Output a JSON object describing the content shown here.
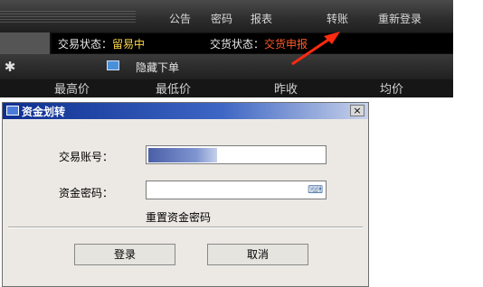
{
  "top_menu": {
    "items": [
      "公告",
      "密码",
      "报表",
      "转账",
      "重新登录"
    ]
  },
  "status": {
    "trade_label": "交易状态：",
    "trade_value": "留易中",
    "delivery_label": "交货状态：",
    "delivery_value": "交货申报"
  },
  "toolbar": {
    "hide_order": "隐藏下单"
  },
  "columns": [
    "最高价",
    "最低价",
    "昨收",
    "均价"
  ],
  "dialog": {
    "title": "资金划转",
    "close": "×",
    "account_label": "交易账号：",
    "password_label": "资金密码：",
    "reset_link": "重置资金密码",
    "login_button": "登录",
    "cancel_button": "取消"
  },
  "colors": {
    "trade_value": "#ffd84a",
    "delivery_value": "#ff5a2a",
    "arrow": "#ff2a10",
    "title_bar": "#0d2f8f"
  }
}
